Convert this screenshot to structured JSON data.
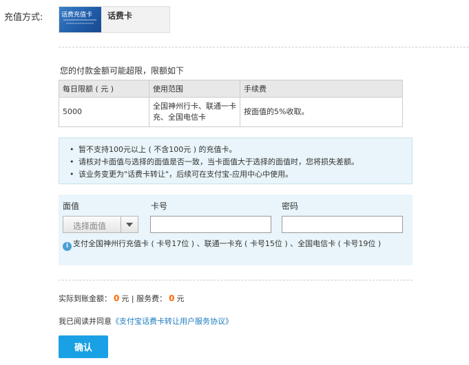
{
  "payment": {
    "method_label": "充值方式:",
    "card_image_text": "话费充值卡",
    "card_name": "话费卡"
  },
  "limits": {
    "title": "您的付款金额可能超限，限额如下",
    "headers": [
      "每日限额 ( 元 )",
      "使用范围",
      "手续费"
    ],
    "row": {
      "daily_limit": "5000",
      "scope": "全国神州行卡、联通一卡充、全国电信卡",
      "fee": "按面值的5%收取。"
    }
  },
  "notice": {
    "items": [
      "暂不支持100元以上 ( 不含100元 ) 的充值卡。",
      "请核对卡面值与选择的面值是否一致，当卡面值大于选择的面值时，您将损失差额。",
      "该业务变更为\"话费卡转让\"，后续可在支付宝-应用中心中使用。"
    ]
  },
  "form": {
    "denomination_label": "面值",
    "denomination_selected": "选择面值",
    "card_no_label": "卡号",
    "card_no_value": "",
    "password_label": "密码",
    "password_value": "",
    "hint": "支付全国神州行充值卡 ( 卡号17位 ) 、联通一卡充 ( 卡号15位 ) 、全国电信卡 ( 卡号19位 )"
  },
  "summary": {
    "actual_label": "实际到账金额：",
    "actual_value": "0",
    "actual_unit": "元",
    "separator": "|",
    "service_label": "服务费：",
    "service_value": "0",
    "service_unit": "元"
  },
  "agreement": {
    "prefix": "我已阅读并同意",
    "link_text": "《支付宝话费卡转让用户服务协议》"
  },
  "confirm_label": "确认",
  "colors": {
    "accent": "#1aa1e5",
    "amount": "#ff6600",
    "link": "#1a7bbf",
    "panel": "#e9f5fa"
  }
}
